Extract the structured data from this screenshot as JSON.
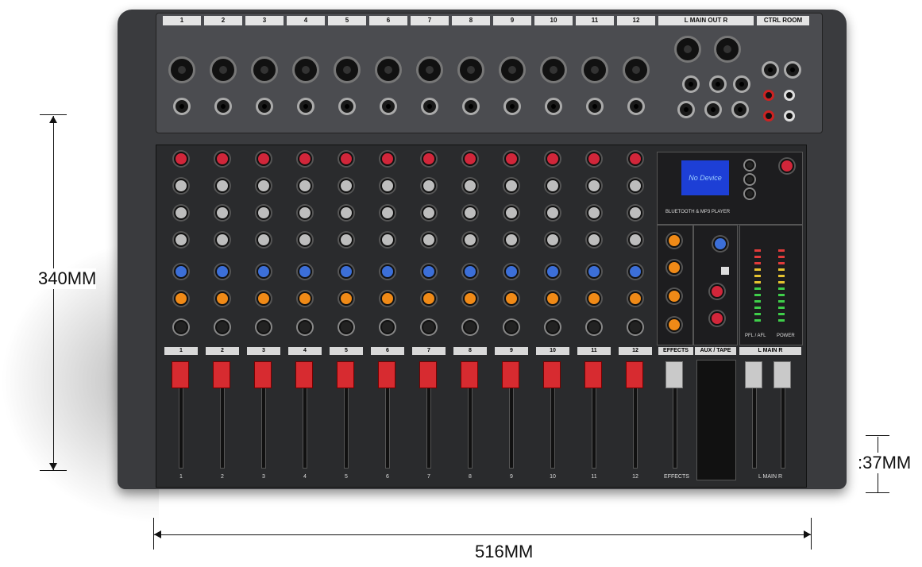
{
  "rear_panel": {
    "channels": [
      "1",
      "2",
      "3",
      "4",
      "5",
      "6",
      "7",
      "8",
      "9",
      "10",
      "11",
      "12"
    ],
    "main_out_label": "L MAIN OUT R",
    "ctrl_room_label": "CTRL ROOM"
  },
  "channel_strips": [
    "1",
    "2",
    "3",
    "4",
    "5",
    "6",
    "7",
    "8",
    "9",
    "10",
    "11",
    "12"
  ],
  "master": {
    "lcd_text": "No Device",
    "player_label": "BLUETOOTH & MP3 PLAYER",
    "effects_label": "EFFECTS",
    "aux_tape_label": "AUX / TAPE",
    "main_label": "L MAIN R",
    "power_label": "POWER",
    "pfl_label": "PFL / AFL"
  },
  "dimensions": {
    "height": "340MM",
    "width": "516MM",
    "depth": ":37MM"
  },
  "colors": {
    "body": "#3a3b3e",
    "gain_knob": "#d1263a",
    "aux_knob": "#3c6fd8",
    "fx_knob": "#f08a17",
    "fader_cap": "#d72b30"
  }
}
